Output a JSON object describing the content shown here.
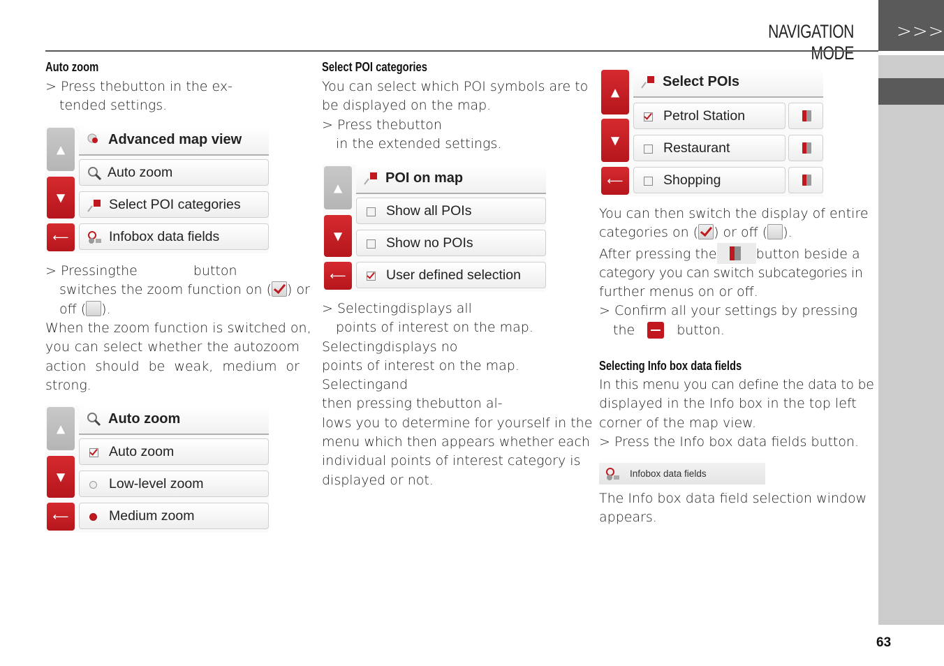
{
  "header": {
    "title": "NAVIGATION MODE",
    "tab_glyph": ">>>",
    "page_number": "63"
  },
  "col1": {
    "heading": "Auto zoom",
    "step1": [
      "> Press the",
      "button in the ex-",
      "tended settings."
    ],
    "menu1": {
      "title": "Advanced map view",
      "items": [
        "Auto zoom",
        "Select POI categories",
        "Infobox data fields"
      ]
    },
    "step2": [
      "> Pressing",
      "the",
      "button",
      "switches the zoom function on (",
      ") or",
      "off (",
      ")."
    ],
    "para": [
      "When the zoom function is switched on,",
      "you can select whether the autozoom",
      "action should be weak, medium or",
      "strong."
    ],
    "menu2": {
      "title": "Auto zoom",
      "items": [
        {
          "label": "Auto zoom",
          "control": "checkbox",
          "checked": true
        },
        {
          "label": "Low-level zoom",
          "control": "radio",
          "checked": false
        },
        {
          "label": "Medium zoom",
          "control": "radio",
          "checked": true
        }
      ]
    }
  },
  "col2": {
    "heading": "Select POI categories",
    "intro": [
      "You can select which POI symbols are to",
      "be displayed on the map."
    ],
    "step1": [
      "> Press the",
      "button",
      "in the extended settings."
    ],
    "menu": {
      "title": "POI on map",
      "items": [
        {
          "label": "Show all POIs",
          "checked": false
        },
        {
          "label": "Show no POIs",
          "checked": false
        },
        {
          "label": "User defined selection",
          "checked": true
        }
      ]
    },
    "step2": [
      "> Selecting",
      "displays all",
      "points of interest on the map."
    ],
    "para1": [
      "Selecting",
      "displays no",
      "points of interest on the map."
    ],
    "para2": [
      "Selecting",
      "and",
      "then pressing the",
      "button al-",
      "lows you to determine for yourself in the",
      "menu which then appears whether each",
      "individual points of interest category is",
      "displayed or not."
    ]
  },
  "col3": {
    "menu": {
      "title": "Select POIs",
      "items": [
        {
          "label": "Petrol Station",
          "checked": true
        },
        {
          "label": "Restaurant",
          "checked": false
        },
        {
          "label": "Shopping",
          "checked": false
        }
      ]
    },
    "para1": [
      "You can then switch the display of entire",
      "categories on (",
      ") or off (",
      ")."
    ],
    "para2": [
      "After pressing the",
      "button beside a",
      "category you can switch subcategories in",
      "further menus on or off."
    ],
    "step": [
      "> Confirm all your settings by pressing",
      "the",
      "button."
    ],
    "heading": "Selecting Info box data fields",
    "para3": [
      "In this menu you can define the data to be",
      "displayed in the Info box in the top left",
      "corner of the map view."
    ],
    "step2": "> Press the Info box data fields button.",
    "infobar_label": "Infobox data fields",
    "para4": [
      "The Info box data field selection window",
      "appears."
    ]
  },
  "colors": {
    "accent_red": "#c0181e",
    "sidebar_dark": "#5a5a5a",
    "sidebar_light": "#cccccc"
  }
}
